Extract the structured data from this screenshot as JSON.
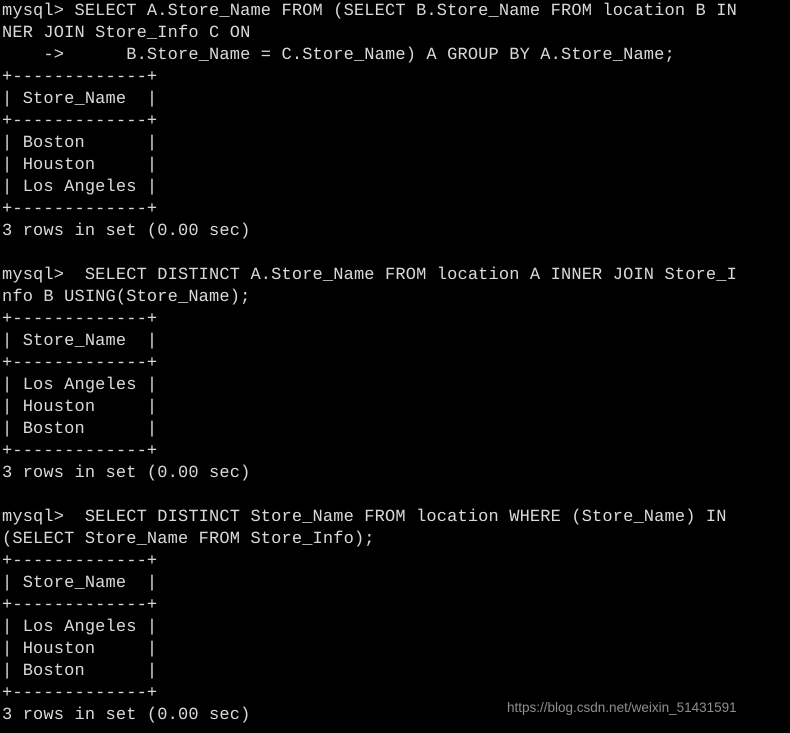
{
  "terminal": {
    "prompt": "mysql>",
    "foreground_color": "#d8d8d8",
    "background_color": "#000000",
    "lines": [
      "mysql> SELECT A.Store_Name FROM (SELECT B.Store_Name FROM location B IN",
      "NER JOIN Store_Info C ON",
      "    ->      B.Store_Name = C.Store_Name) A GROUP BY A.Store_Name;",
      "+-------------+",
      "| Store_Name  |",
      "+-------------+",
      "| Boston      |",
      "| Houston     |",
      "| Los Angeles |",
      "+-------------+",
      "3 rows in set (0.00 sec)",
      "",
      "mysql>  SELECT DISTINCT A.Store_Name FROM location A INNER JOIN Store_I",
      "nfo B USING(Store_Name);",
      "+-------------+",
      "| Store_Name  |",
      "+-------------+",
      "| Los Angeles |",
      "| Houston     |",
      "| Boston      |",
      "+-------------+",
      "3 rows in set (0.00 sec)",
      "",
      "mysql>  SELECT DISTINCT Store_Name FROM location WHERE (Store_Name) IN",
      "(SELECT Store_Name FROM Store_Info);",
      "+-------------+",
      "| Store_Name  |",
      "+-------------+",
      "| Los Angeles |",
      "| Houston     |",
      "| Boston      |",
      "+-------------+",
      "3 rows in set (0.00 sec)"
    ],
    "queries": [
      {
        "sql": "SELECT A.Store_Name FROM (SELECT B.Store_Name FROM location B INNER JOIN Store_Info C ON B.Store_Name = C.Store_Name) A GROUP BY A.Store_Name;",
        "column_header": "Store_Name",
        "rows": [
          "Boston",
          "Houston",
          "Los Angeles"
        ],
        "status": "3 rows in set (0.00 sec)"
      },
      {
        "sql": "SELECT DISTINCT A.Store_Name FROM location A INNER JOIN Store_Info B USING(Store_Name);",
        "column_header": "Store_Name",
        "rows": [
          "Los Angeles",
          "Houston",
          "Boston"
        ],
        "status": "3 rows in set (0.00 sec)"
      },
      {
        "sql": "SELECT DISTINCT Store_Name FROM location WHERE (Store_Name) IN (SELECT Store_Name FROM Store_Info);",
        "column_header": "Store_Name",
        "rows": [
          "Los Angeles",
          "Houston",
          "Boston"
        ],
        "status": "3 rows in set (0.00 sec)"
      }
    ]
  },
  "watermark": {
    "text": "https://blog.csdn.net/weixin_51431591",
    "color": "#8e8e8e"
  }
}
